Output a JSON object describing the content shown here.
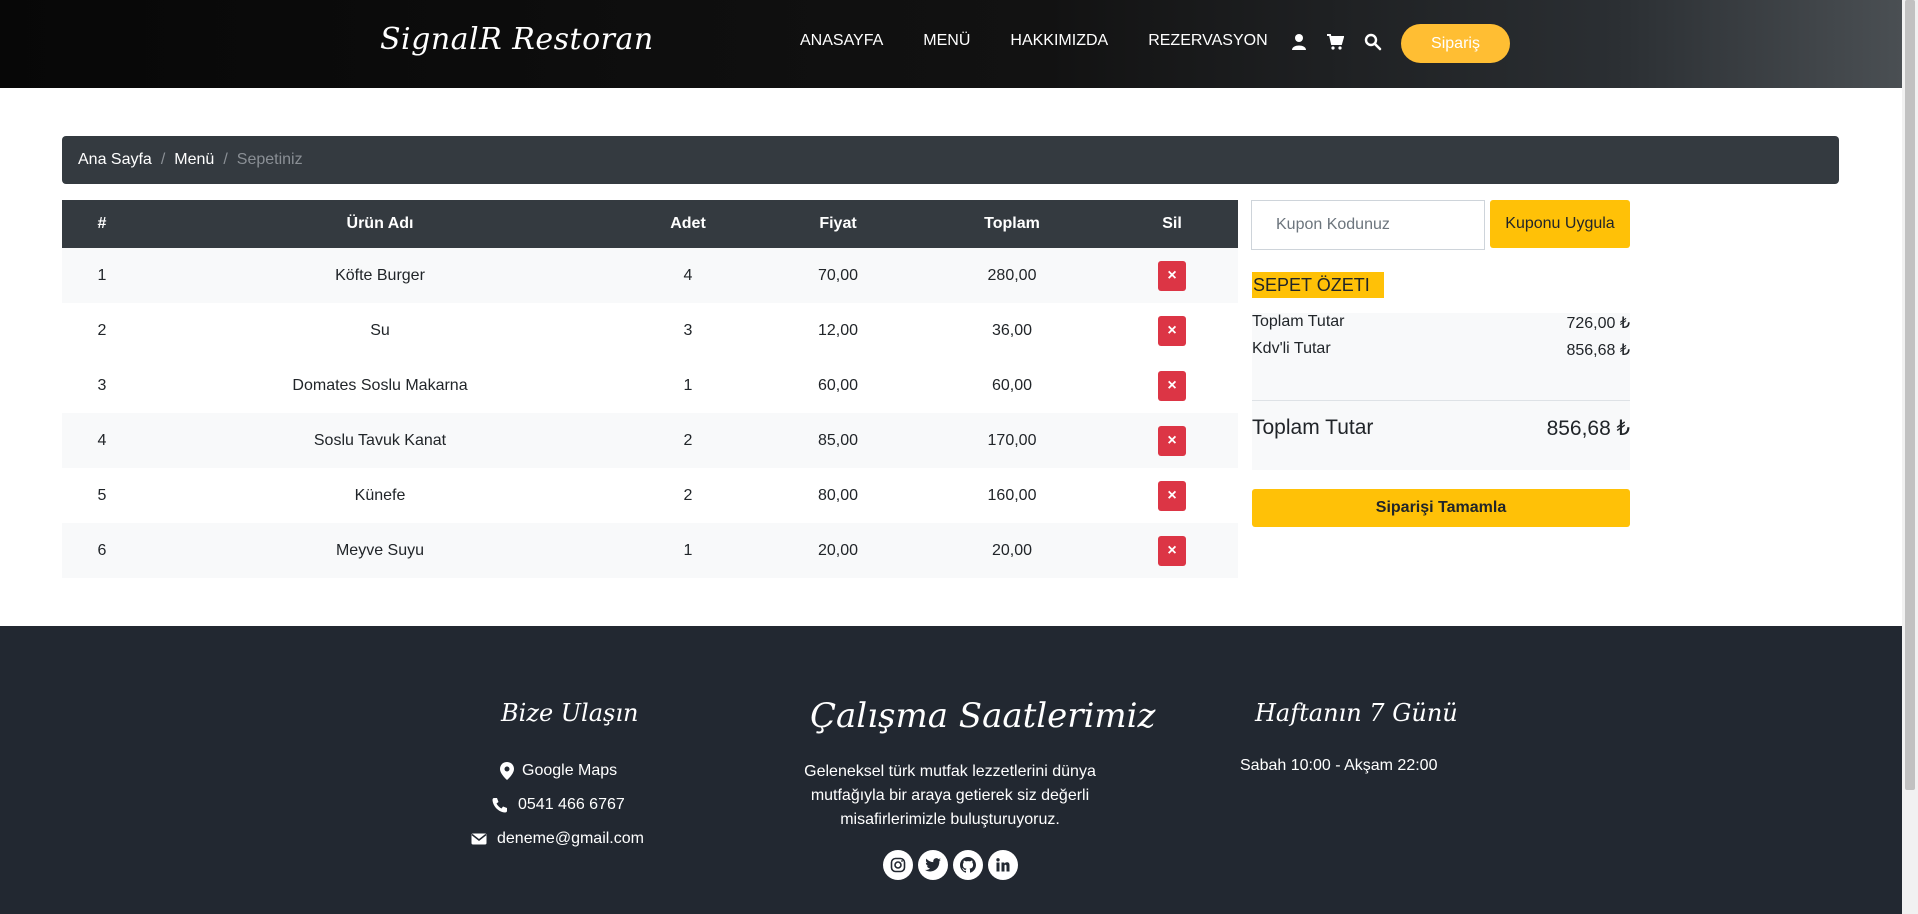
{
  "navbar": {
    "brand": "SignalR Restoran",
    "links": [
      "ANASAYFA",
      "MENÜ",
      "HAKKIMIZDA",
      "REZERVASYON"
    ],
    "icons": [
      "user-icon",
      "cart-icon",
      "search-icon"
    ],
    "order_button": "Sipariş"
  },
  "breadcrumb": {
    "items": [
      "Ana Sayfa",
      "Menü"
    ],
    "active": "Sepetiniz"
  },
  "cart": {
    "headers": [
      "#",
      "Ürün Adı",
      "Adet",
      "Fiyat",
      "Toplam",
      "Sil"
    ],
    "delete_label": "×",
    "rows": [
      {
        "no": "1",
        "name": "Köfte Burger",
        "qty": "4",
        "price": "70,00",
        "total": "280,00"
      },
      {
        "no": "2",
        "name": "Su",
        "qty": "3",
        "price": "12,00",
        "total": "36,00"
      },
      {
        "no": "3",
        "name": "Domates Soslu Makarna",
        "qty": "1",
        "price": "60,00",
        "total": "60,00"
      },
      {
        "no": "4",
        "name": "Soslu Tavuk Kanat",
        "qty": "2",
        "price": "85,00",
        "total": "170,00"
      },
      {
        "no": "5",
        "name": "Künefe",
        "qty": "2",
        "price": "80,00",
        "total": "160,00"
      },
      {
        "no": "6",
        "name": "Meyve Suyu",
        "qty": "1",
        "price": "20,00",
        "total": "20,00"
      }
    ]
  },
  "coupon": {
    "placeholder": "Kupon Kodunuz",
    "button": "Kuponu Uygula"
  },
  "summary": {
    "title": "SEPET ÖZETI",
    "subtotal_label": "Toplam Tutar",
    "subtotal_value": "726,00 ₺",
    "vat_label": "Kdv'li Tutar",
    "vat_value": "856,68 ₺",
    "total_label": "Toplam Tutar",
    "total_value": "856,68 ₺",
    "complete_button": "Siparişi Tamamla"
  },
  "footer": {
    "contact_heading": "Bize Ulaşın",
    "maps": "Google Maps",
    "phone": "0541 466 6767",
    "email": "deneme@gmail.com",
    "hours_heading": "Çalışma Saatlerimiz",
    "description": "Geleneksel türk mutfak lezzetlerini dünya mutfağıyla bir araya getierek siz değerli misafirlerimizle buluşturuyoruz.",
    "social_icons": [
      "instagram-icon",
      "twitter-icon",
      "github-icon",
      "linkedin-icon"
    ],
    "days_heading": "Haftanın 7 Günü",
    "hours": "Sabah 10:00 - Akşam 22:00"
  },
  "colors": {
    "accent": "#ffc107",
    "order_button": "#ffbe33",
    "dark": "#343a40",
    "footer": "#222831",
    "danger": "#dc3545"
  }
}
